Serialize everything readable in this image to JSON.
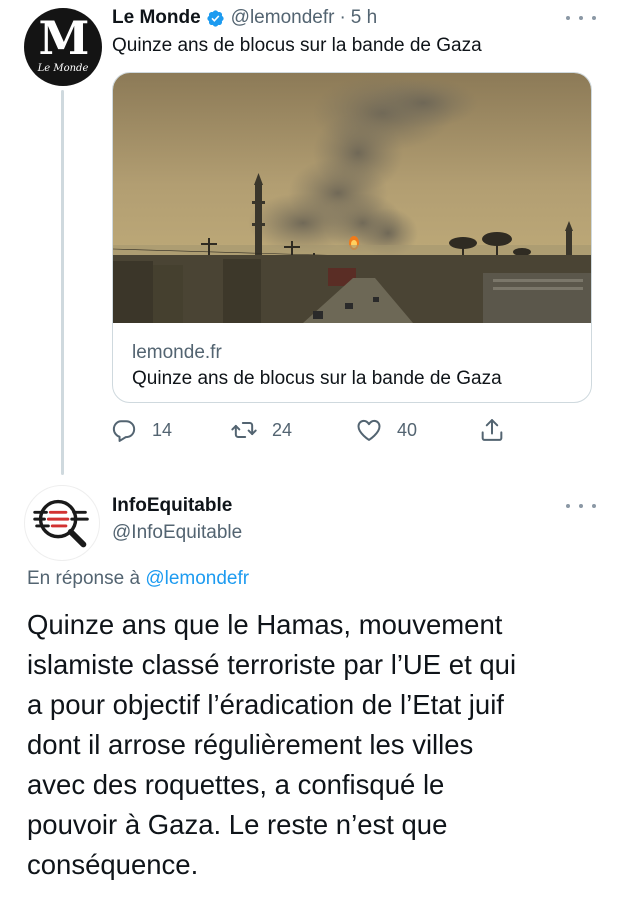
{
  "tweet1": {
    "author": {
      "name": "Le Monde",
      "handle": "@lemondefr",
      "separator": "·",
      "time": "5 h",
      "avatar_letter": "M",
      "avatar_caption": "Le Monde",
      "verified": true
    },
    "text": "Quinze ans de blocus sur la bande de Gaza",
    "card": {
      "image": "smoke-over-gaza-skyline",
      "domain": "lemonde.fr",
      "title": "Quinze ans de blocus sur la bande de Gaza"
    },
    "actions": {
      "reply_count": "14",
      "retweet_count": "24",
      "like_count": "40"
    }
  },
  "tweet2": {
    "author": {
      "name": "InfoEquitable",
      "handle": "@InfoEquitable"
    },
    "reply_prefix": "En réponse à",
    "reply_mention": "@lemondefr",
    "body_lines": [
      "Quinze ans que le Hamas, mouvement",
      "islamiste classé terroriste par l’UE et qui",
      "a pour objectif l’éradication de l’Etat juif",
      "dont il arrose régulièrement les villes",
      "avec des roquettes, a confisqué le",
      "pouvoir à Gaza. Le reste n’est que",
      "conséquence."
    ]
  },
  "colors": {
    "accent": "#1d9bf0",
    "secondary_text": "#536471",
    "border": "#cfd9de"
  }
}
